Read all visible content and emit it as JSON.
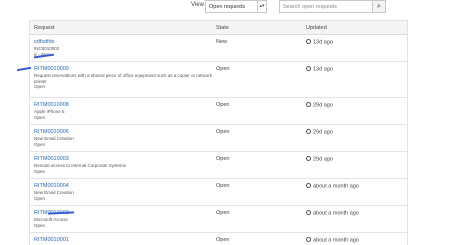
{
  "filters": {
    "view_label": "View",
    "view_selected": "Open requests",
    "search_placeholder": "Search open requests"
  },
  "table": {
    "headers": {
      "request": "Request",
      "state": "State",
      "updated": "Updated"
    },
    "rows": [
      {
        "number": "sdfsdfds",
        "desc": "INC0010002",
        "status": "d - Inter",
        "state": "New",
        "updated": "13d ago"
      },
      {
        "number": "RITM0010009",
        "desc": "Request reservations with a shared piece of office equipment such as a copier or network printer",
        "status": "Open",
        "state": "Open",
        "updated": "13d ago"
      },
      {
        "number": "RITM0010008",
        "desc": "Apple iPhone 5",
        "status": "Open",
        "state": "Open",
        "updated": "29d ago"
      },
      {
        "number": "RITM0010006",
        "desc": "New Email Creation",
        "status": "Open",
        "state": "Open",
        "updated": "29d ago"
      },
      {
        "number": "RITM0010003",
        "desc": "Remote access to Internal Corporate Systems",
        "status": "Open",
        "state": "Open",
        "updated": "29d ago"
      },
      {
        "number": "RITM0010004",
        "desc": "New Email Creation",
        "status": "Open",
        "state": "Open",
        "updated": "about a month ago"
      },
      {
        "number": "RITM0010002",
        "desc": "Microsoft Access",
        "status": "Open",
        "state": "Open",
        "updated": "about a month ago"
      },
      {
        "number": "RITM0010001",
        "desc": "",
        "status": "",
        "state": "Open",
        "updated": "about a month ago"
      }
    ]
  }
}
